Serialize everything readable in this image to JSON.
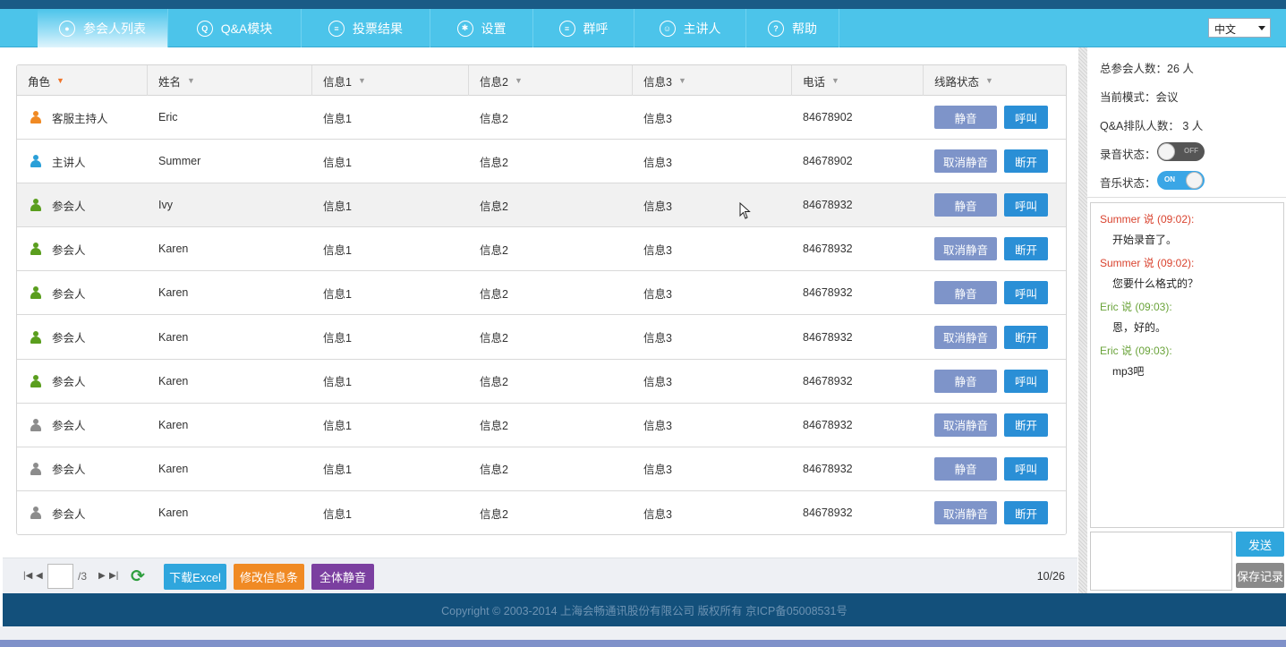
{
  "nav": {
    "tabs": [
      {
        "label": "参会人列表",
        "icon": "user-circle-icon",
        "glyph": "●",
        "active": true
      },
      {
        "label": "Q&A模块",
        "icon": "qa-icon",
        "glyph": "Q",
        "active": false
      },
      {
        "label": "投票结果",
        "icon": "list-icon",
        "glyph": "≡",
        "active": false
      },
      {
        "label": "设置",
        "icon": "gear-icon",
        "glyph": "✱",
        "active": false
      },
      {
        "label": "群呼",
        "icon": "broadcast-icon",
        "glyph": "≡",
        "active": false
      },
      {
        "label": "主讲人",
        "icon": "speaker-icon",
        "glyph": "☺",
        "active": false
      },
      {
        "label": "帮助",
        "icon": "help-icon",
        "glyph": "?",
        "active": false
      }
    ],
    "language": "中文"
  },
  "table": {
    "columns": [
      {
        "label": "角色",
        "active_sort": true
      },
      {
        "label": "姓名",
        "active_sort": false
      },
      {
        "label": "信息1",
        "active_sort": false
      },
      {
        "label": "信息2",
        "active_sort": false
      },
      {
        "label": "信息3",
        "active_sort": false
      },
      {
        "label": "电话",
        "active_sort": false
      },
      {
        "label": "线路状态",
        "active_sort": false
      }
    ],
    "rows": [
      {
        "role": "客服主持人",
        "icon_color": "#f08a24",
        "name": "Eric",
        "info1": "信息1",
        "info2": "信息2",
        "info3": "信息3",
        "phone": "84678902",
        "mute": "静音",
        "action": "呼叫",
        "highlighted": false
      },
      {
        "role": "主讲人",
        "icon_color": "#2a9fd8",
        "name": "Summer",
        "info1": "信息1",
        "info2": "信息2",
        "info3": "信息3",
        "phone": "84678902",
        "mute": "取消静音",
        "action": "断开",
        "highlighted": false
      },
      {
        "role": "参会人",
        "icon_color": "#5a9e1e",
        "name": "Ivy",
        "info1": "信息1",
        "info2": "信息2",
        "info3": "信息3",
        "phone": "84678932",
        "mute": "静音",
        "action": "呼叫",
        "highlighted": true
      },
      {
        "role": "参会人",
        "icon_color": "#5a9e1e",
        "name": "Karen",
        "info1": "信息1",
        "info2": "信息2",
        "info3": "信息3",
        "phone": "84678932",
        "mute": "取消静音",
        "action": "断开",
        "highlighted": false
      },
      {
        "role": "参会人",
        "icon_color": "#5a9e1e",
        "name": "Karen",
        "info1": "信息1",
        "info2": "信息2",
        "info3": "信息3",
        "phone": "84678932",
        "mute": "静音",
        "action": "呼叫",
        "highlighted": false
      },
      {
        "role": "参会人",
        "icon_color": "#5a9e1e",
        "name": "Karen",
        "info1": "信息1",
        "info2": "信息2",
        "info3": "信息3",
        "phone": "84678932",
        "mute": "取消静音",
        "action": "断开",
        "highlighted": false
      },
      {
        "role": "参会人",
        "icon_color": "#5a9e1e",
        "name": "Karen",
        "info1": "信息1",
        "info2": "信息2",
        "info3": "信息3",
        "phone": "84678932",
        "mute": "静音",
        "action": "呼叫",
        "highlighted": false
      },
      {
        "role": "参会人",
        "icon_color": "#8c8c8c",
        "name": "Karen",
        "info1": "信息1",
        "info2": "信息2",
        "info3": "信息3",
        "phone": "84678932",
        "mute": "取消静音",
        "action": "断开",
        "highlighted": false
      },
      {
        "role": "参会人",
        "icon_color": "#8c8c8c",
        "name": "Karen",
        "info1": "信息1",
        "info2": "信息2",
        "info3": "信息3",
        "phone": "84678932",
        "mute": "静音",
        "action": "呼叫",
        "highlighted": false
      },
      {
        "role": "参会人",
        "icon_color": "#8c8c8c",
        "name": "Karen",
        "info1": "信息1",
        "info2": "信息2",
        "info3": "信息3",
        "phone": "84678932",
        "mute": "取消静音",
        "action": "断开",
        "highlighted": false
      }
    ]
  },
  "pager": {
    "page_value": "",
    "total_pages": "/3",
    "download_label": "下载Excel",
    "edit_label": "修改信息条",
    "mute_all_label": "全体静音",
    "count": "10/26"
  },
  "side": {
    "total": "总参会人数：26 人",
    "mode": "当前模式：会议",
    "qa_queue": "Q&A排队人数： 3 人",
    "record_label": "录音状态：",
    "record_toggle": "OFF",
    "music_label": "音乐状态：",
    "music_toggle": "ON",
    "messages": [
      {
        "header": "Summer 说 (09:02):",
        "color": "#d9432f",
        "body": "开始录音了。"
      },
      {
        "header": "Summer 说 (09:02):",
        "color": "#d9432f",
        "body": "您要什么格式的？"
      },
      {
        "header": "Eric 说 (09:03):",
        "color": "#6aa33a",
        "body": "恩，好的。"
      },
      {
        "header": "Eric 说 (09:03):",
        "color": "#6aa33a",
        "body": "mp3吧"
      }
    ],
    "send_label": "发送",
    "save_label": "保存记录"
  },
  "footer": {
    "copyright": "Copyright © 2003-2014 上海会畅通讯股份有限公司 版权所有 京ICP备05008531号"
  }
}
